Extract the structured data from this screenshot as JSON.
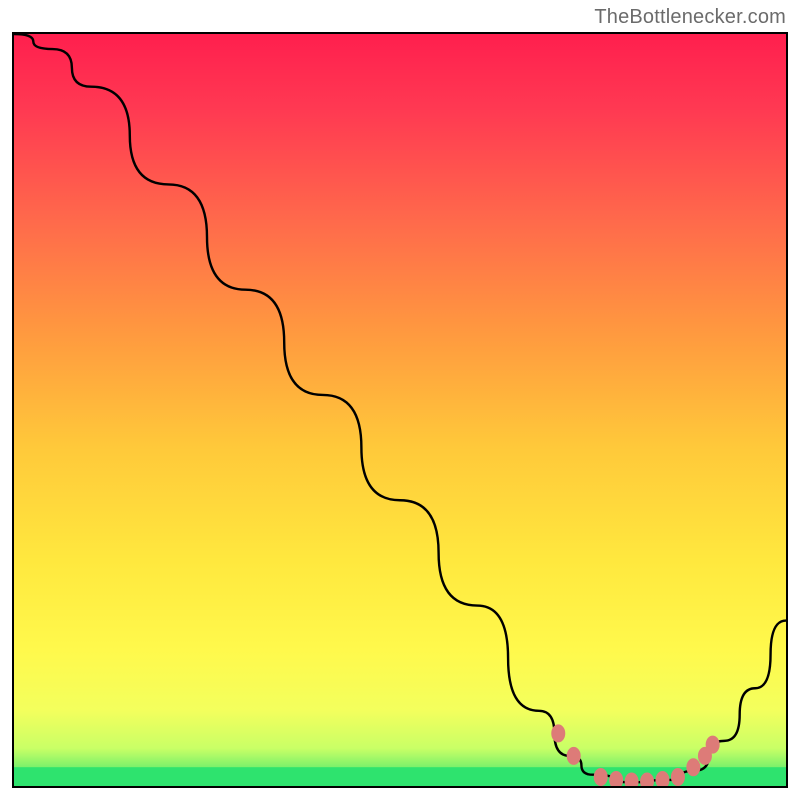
{
  "attribution": "TheBottlenecker.com",
  "chart_data": {
    "type": "line",
    "title": "",
    "xlabel": "",
    "ylabel": "",
    "xlim": [
      0,
      100
    ],
    "ylim": [
      0,
      100
    ],
    "curve": [
      {
        "x": 0,
        "y": 100
      },
      {
        "x": 5,
        "y": 98
      },
      {
        "x": 10,
        "y": 93
      },
      {
        "x": 20,
        "y": 80
      },
      {
        "x": 30,
        "y": 66
      },
      {
        "x": 40,
        "y": 52
      },
      {
        "x": 50,
        "y": 38
      },
      {
        "x": 60,
        "y": 24
      },
      {
        "x": 68,
        "y": 10
      },
      {
        "x": 72,
        "y": 4
      },
      {
        "x": 75,
        "y": 1.5
      },
      {
        "x": 80,
        "y": 0.5
      },
      {
        "x": 85,
        "y": 0.8
      },
      {
        "x": 88,
        "y": 2
      },
      {
        "x": 92,
        "y": 6
      },
      {
        "x": 96,
        "y": 13
      },
      {
        "x": 100,
        "y": 22
      }
    ],
    "markers": [
      {
        "x": 70.5,
        "y": 7.0
      },
      {
        "x": 72.5,
        "y": 4.0
      },
      {
        "x": 76.0,
        "y": 1.2
      },
      {
        "x": 78.0,
        "y": 0.8
      },
      {
        "x": 80.0,
        "y": 0.6
      },
      {
        "x": 82.0,
        "y": 0.6
      },
      {
        "x": 84.0,
        "y": 0.8
      },
      {
        "x": 86.0,
        "y": 1.2
      },
      {
        "x": 88.0,
        "y": 2.5
      },
      {
        "x": 89.5,
        "y": 4.0
      },
      {
        "x": 90.5,
        "y": 5.5
      }
    ],
    "bottom_band_y": 2.5,
    "bottom_band_color": "#2ee36e",
    "gradient_stops": [
      {
        "offset": 0.0,
        "color": "#ff1f4e"
      },
      {
        "offset": 0.1,
        "color": "#ff3952"
      },
      {
        "offset": 0.25,
        "color": "#ff6a4b"
      },
      {
        "offset": 0.4,
        "color": "#ff9a3f"
      },
      {
        "offset": 0.55,
        "color": "#ffc93a"
      },
      {
        "offset": 0.7,
        "color": "#ffe83e"
      },
      {
        "offset": 0.82,
        "color": "#fff94c"
      },
      {
        "offset": 0.9,
        "color": "#f3ff5d"
      },
      {
        "offset": 0.95,
        "color": "#c9ff66"
      },
      {
        "offset": 1.0,
        "color": "#2ee36e"
      }
    ],
    "marker_color": "#dd7b78",
    "line_color": "#000000"
  }
}
